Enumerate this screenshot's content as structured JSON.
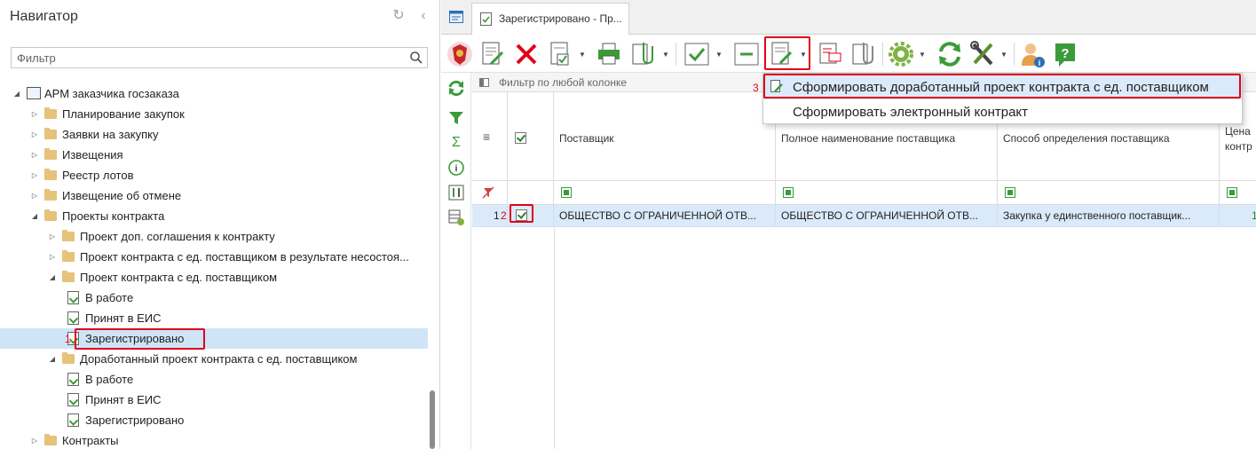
{
  "navigator": {
    "title": "Навигатор",
    "filter_placeholder": "Фильтр",
    "tree": [
      {
        "label": "АРМ заказчика госзаказа",
        "level": 0,
        "type": "arm",
        "expanded": true
      },
      {
        "label": "Планирование закупок",
        "level": 1,
        "type": "folder",
        "expanded": false
      },
      {
        "label": "Заявки на закупку",
        "level": 1,
        "type": "folder",
        "expanded": false
      },
      {
        "label": "Извещения",
        "level": 1,
        "type": "folder",
        "expanded": false
      },
      {
        "label": "Реестр лотов",
        "level": 1,
        "type": "folder",
        "expanded": false
      },
      {
        "label": "Извещение об отмене",
        "level": 1,
        "type": "folder",
        "expanded": false
      },
      {
        "label": "Проекты контракта",
        "level": 1,
        "type": "folder",
        "expanded": true
      },
      {
        "label": "Проект доп. соглашения к контракту",
        "level": 2,
        "type": "folder",
        "expanded": false
      },
      {
        "label": "Проект контракта с ед. поставщиком в результате несостоя...",
        "level": 2,
        "type": "folder",
        "expanded": false
      },
      {
        "label": "Проект контракта с ед. поставщиком",
        "level": 2,
        "type": "folder",
        "expanded": true
      },
      {
        "label": "В работе",
        "level": 3,
        "type": "doc"
      },
      {
        "label": "Принят в ЕИС",
        "level": 3,
        "type": "doc"
      },
      {
        "label": "Зарегистрировано",
        "level": 3,
        "type": "doc",
        "selected": true
      },
      {
        "label": "Доработанный проект контракта с ед. поставщиком",
        "level": 2,
        "type": "folder",
        "expanded": true
      },
      {
        "label": "В работе",
        "level": 3,
        "type": "doc"
      },
      {
        "label": "Принят в ЕИС",
        "level": 3,
        "type": "doc"
      },
      {
        "label": "Зарегистрировано",
        "level": 3,
        "type": "doc"
      },
      {
        "label": "Контракты",
        "level": 1,
        "type": "folder",
        "expanded": false
      }
    ]
  },
  "annotations": {
    "one": "1",
    "two": "2",
    "three": "3"
  },
  "tabs": {
    "active_label": "Зарегистрировано - Пр..."
  },
  "grid": {
    "filter_placeholder": "Фильтр по любой колонке",
    "columns": [
      "Поставщик",
      "Полное наименование поставщика",
      "Способ определения поставщика",
      "Цена контр"
    ],
    "rows": [
      {
        "num": "1",
        "checked": true,
        "cells": [
          "ОБЩЕСТВО С ОГРАНИЧЕННОЙ ОТВ...",
          "ОБЩЕСТВО С ОГРАНИЧЕННОЙ ОТВ...",
          "Закупка у единственного поставщик...",
          "1"
        ]
      }
    ]
  },
  "menu": {
    "items": [
      {
        "label": "Сформировать доработанный проект контракта с ед. поставщиком",
        "highlighted": true
      },
      {
        "label": "Сформировать электронный контракт",
        "highlighted": false
      }
    ]
  },
  "colors": {
    "accent_red": "#e0001b",
    "selection": "#cfe4f7",
    "row_selection": "#dbeafa",
    "green": "#3b9b3b"
  }
}
